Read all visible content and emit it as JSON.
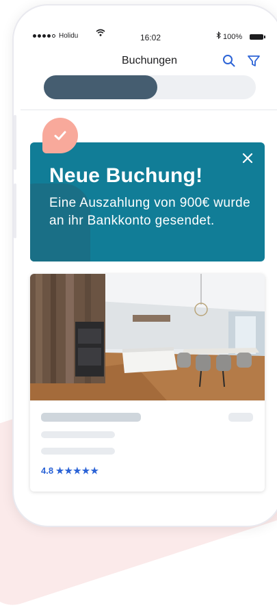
{
  "status_bar": {
    "carrier": "Holidu",
    "time": "16:02",
    "battery": "100%"
  },
  "nav": {
    "title": "Buchungen",
    "search_icon": "search-icon",
    "filter_icon": "filter-icon"
  },
  "segmented": {
    "active_index": 0
  },
  "notification": {
    "icon": "check-icon",
    "title": "Neue Buchung!",
    "message": "Eine Auszahlung von 900€ wurde an ihr Bankkonto gesendet.",
    "close_icon": "close-icon"
  },
  "listing": {
    "rating": "4.8",
    "stars": "★★★★★",
    "star_value": 4.8
  },
  "colors": {
    "notification_bg": "#117d97",
    "accent": "#2b63d6",
    "check_bubble": "#f8a99b",
    "segment_active": "#455d70"
  }
}
